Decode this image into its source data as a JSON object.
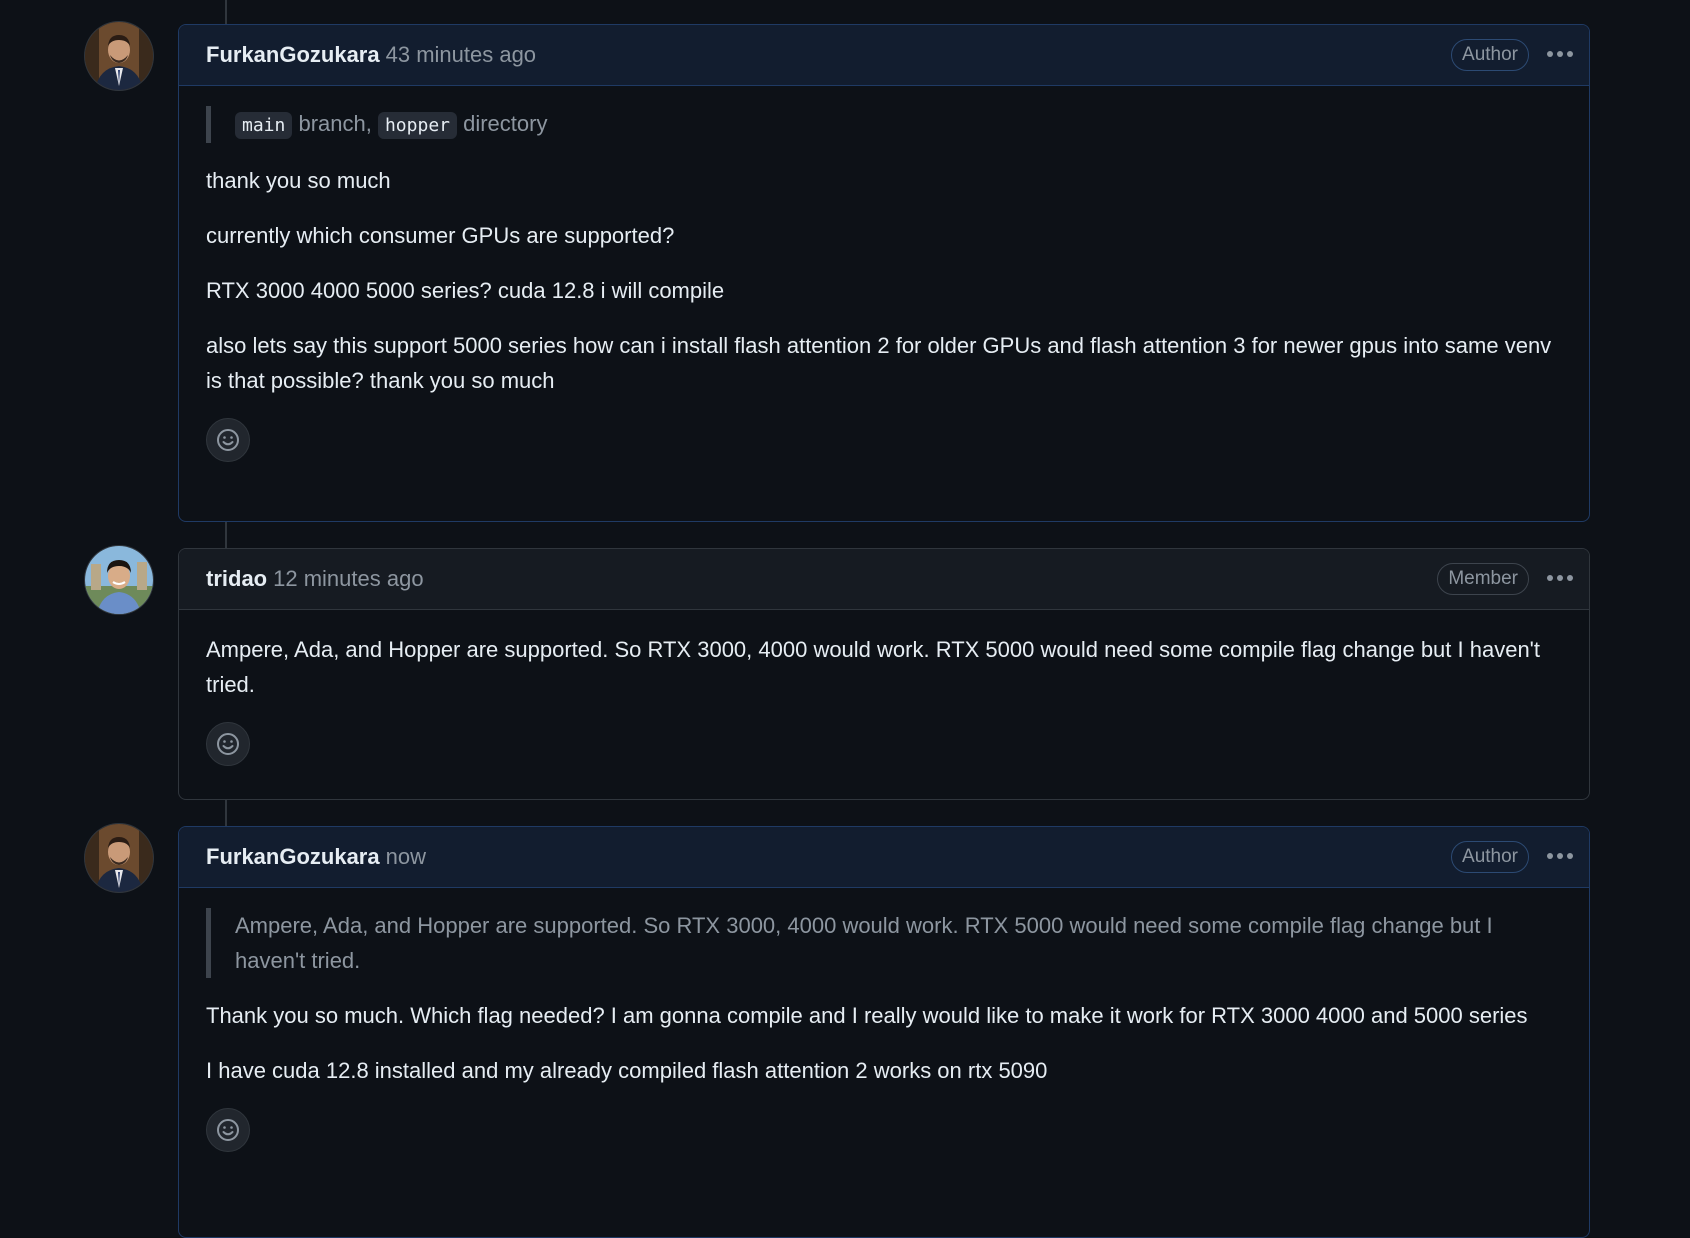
{
  "comments": [
    {
      "username": "FurkanGozukara",
      "timestamp": "43 minutes ago",
      "role": "Author",
      "quote": {
        "code1": "main",
        "text1": " branch, ",
        "code2": "hopper",
        "text2": " directory"
      },
      "paragraphs": [
        "thank you so much",
        "currently which consumer GPUs are supported?",
        "RTX 3000 4000 5000 series? cuda 12.8 i will compile",
        "also lets say this support 5000 series how can i install flash attention 2 for older GPUs and flash attention 3 for newer gpus into same venv is that possible? thank you so much"
      ]
    },
    {
      "username": "tridao",
      "timestamp": "12 minutes ago",
      "role": "Member",
      "paragraphs": [
        "Ampere, Ada, and Hopper are supported. So RTX 3000, 4000 would work. RTX 5000 would need some compile flag change but I haven't tried."
      ]
    },
    {
      "username": "FurkanGozukara",
      "timestamp": "now",
      "role": "Author",
      "quote": {
        "text": "Ampere, Ada, and Hopper are supported. So RTX 3000, 4000 would work. RTX 5000 would need some compile flag change but I haven't tried."
      },
      "paragraphs": [
        "Thank you so much. Which flag needed? I am gonna compile and I really would like to make it work for RTX 3000 4000 and 5000 series",
        "I have cuda 12.8 installed and my already compiled flash attention 2 works on rtx 5090"
      ]
    }
  ],
  "icons": {
    "more": "kebab-horizontal-icon",
    "reaction": "smiley-icon"
  },
  "colors": {
    "background": "#0d1117",
    "author_header": "#121d2f",
    "member_header": "#161b22",
    "muted_text": "#8d96a0"
  }
}
